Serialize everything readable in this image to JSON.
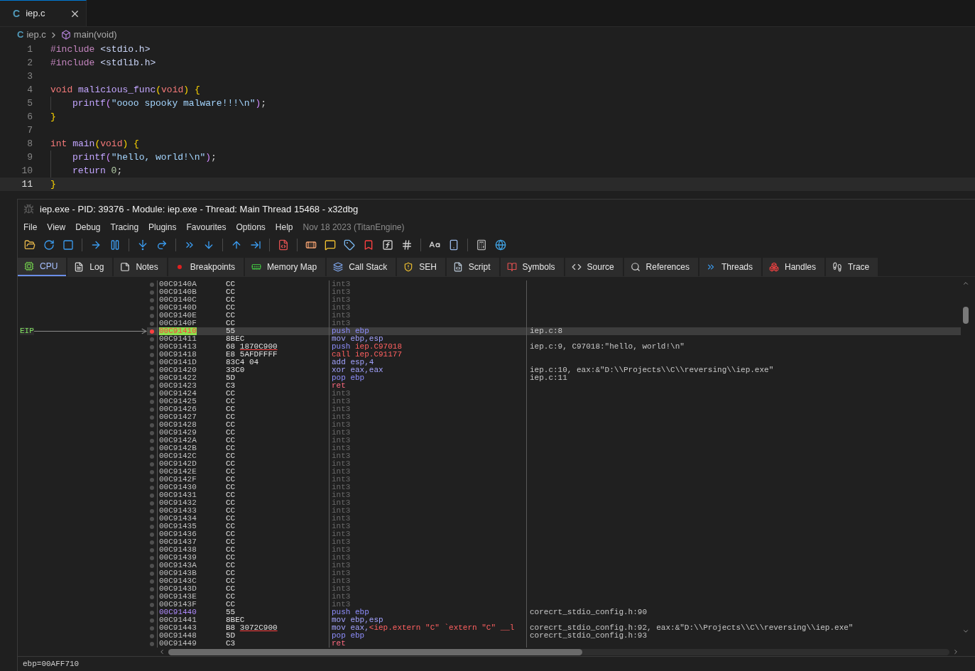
{
  "editor": {
    "tab": {
      "glyph": "C",
      "label": "iep.c",
      "selected": true
    },
    "breadcrumb": {
      "file_glyph": "C",
      "file": "iep.c",
      "symbol": "main(void)"
    },
    "lines": [
      {
        "number": "1",
        "indented": false,
        "selected": false,
        "tokens": [
          {
            "text": "#include",
            "kind": "preproc"
          },
          {
            "text": " <stdio.h>",
            "kind": "path"
          }
        ]
      },
      {
        "number": "2",
        "indented": false,
        "selected": false,
        "tokens": [
          {
            "text": "#include",
            "kind": "preproc"
          },
          {
            "text": " <stdlib.h>",
            "kind": "path"
          }
        ]
      },
      {
        "number": "3",
        "selected": false
      },
      {
        "number": "4",
        "indented": false,
        "selected": false,
        "tokens": [
          {
            "text": "void",
            "kind": "keyword"
          },
          {
            "text": " malicious_func",
            "kind": "func"
          },
          {
            "text": "(",
            "kind": "paren"
          },
          {
            "text": "void",
            "kind": "keyword"
          },
          {
            "text": ")",
            "kind": "paren"
          },
          {
            "text": " {",
            "kind": "paren"
          }
        ]
      },
      {
        "number": "5",
        "indented": true,
        "selected": false,
        "tokens": [
          {
            "text": "printf",
            "kind": "func"
          },
          {
            "text": "(",
            "kind": "paren2"
          },
          {
            "text": "\"oooo spooky malware!!!\\n\"",
            "kind": "string"
          },
          {
            "text": ")",
            "kind": "paren2"
          },
          {
            "text": ";",
            "kind": "plain"
          }
        ]
      },
      {
        "number": "6",
        "indented": false,
        "selected": false,
        "tokens": [
          {
            "text": "}",
            "kind": "paren"
          }
        ]
      },
      {
        "number": "7",
        "selected": false
      },
      {
        "number": "8",
        "indented": false,
        "selected": false,
        "tokens": [
          {
            "text": "int",
            "kind": "keyword"
          },
          {
            "text": " main",
            "kind": "func"
          },
          {
            "text": "(",
            "kind": "paren"
          },
          {
            "text": "void",
            "kind": "keyword"
          },
          {
            "text": ")",
            "kind": "paren"
          },
          {
            "text": " {",
            "kind": "paren"
          }
        ]
      },
      {
        "number": "9",
        "indented": true,
        "selected": false,
        "tokens": [
          {
            "text": "printf",
            "kind": "func"
          },
          {
            "text": "(",
            "kind": "paren2"
          },
          {
            "text": "\"hello, world!\\n\"",
            "kind": "string"
          },
          {
            "text": ")",
            "kind": "paren2"
          },
          {
            "text": ";",
            "kind": "plain"
          }
        ]
      },
      {
        "number": "10",
        "indented": true,
        "selected": false,
        "tokens": [
          {
            "text": "return",
            "kind": "control"
          },
          {
            "text": " 0",
            "kind": "number"
          },
          {
            "text": ";",
            "kind": "plain"
          }
        ]
      },
      {
        "number": "11",
        "indented": false,
        "selected": true,
        "tokens": [
          {
            "text": "}",
            "kind": "paren"
          }
        ]
      }
    ]
  },
  "debugger": {
    "title": "iep.exe - PID: 39376 - Module: iep.exe - Thread: Main Thread 15468 - x32dbg",
    "menu": [
      "File",
      "View",
      "Debug",
      "Tracing",
      "Plugins",
      "Favourites",
      "Options",
      "Help"
    ],
    "build_info": "Nov 18 2023 (TitanEngine)",
    "tabs": [
      {
        "label": "CPU",
        "selected": true
      },
      {
        "label": "Log",
        "selected": false
      },
      {
        "label": "Notes",
        "selected": false
      },
      {
        "label": "Breakpoints",
        "selected": false
      },
      {
        "label": "Memory Map",
        "selected": false
      },
      {
        "label": "Call Stack",
        "selected": false
      },
      {
        "label": "SEH",
        "selected": false
      },
      {
        "label": "Script",
        "selected": false
      },
      {
        "label": "Symbols",
        "selected": false
      },
      {
        "label": "Source",
        "selected": false
      },
      {
        "label": "References",
        "selected": false
      },
      {
        "label": "Threads",
        "selected": false
      },
      {
        "label": "Handles",
        "selected": false
      },
      {
        "label": "Trace",
        "selected": false
      }
    ],
    "rows": [
      {
        "address": "00C9140A",
        "kind": "plain",
        "bytes": "CC",
        "instruction": [
          {
            "text": "int3",
            "kind": "int3"
          }
        ],
        "selected": false,
        "breakpoint": false
      },
      {
        "address": "00C9140B",
        "kind": "plain",
        "bytes": "CC",
        "instruction": [
          {
            "text": "int3",
            "kind": "int3"
          }
        ],
        "selected": false,
        "breakpoint": false
      },
      {
        "address": "00C9140C",
        "kind": "plain",
        "bytes": "CC",
        "instruction": [
          {
            "text": "int3",
            "kind": "int3"
          }
        ],
        "selected": false,
        "breakpoint": false
      },
      {
        "address": "00C9140D",
        "kind": "plain",
        "bytes": "CC",
        "instruction": [
          {
            "text": "int3",
            "kind": "int3"
          }
        ],
        "selected": false,
        "breakpoint": false
      },
      {
        "address": "00C9140E",
        "kind": "plain",
        "bytes": "CC",
        "instruction": [
          {
            "text": "int3",
            "kind": "int3"
          }
        ],
        "selected": false,
        "breakpoint": false
      },
      {
        "address": "00C9140F",
        "kind": "plain",
        "bytes": "CC",
        "instruction": [
          {
            "text": "int3",
            "kind": "int3"
          }
        ],
        "selected": false,
        "breakpoint": false
      },
      {
        "address": "00C91410",
        "kind": "eip",
        "eip_label": "EIP",
        "bytes": "55",
        "instruction": [
          {
            "text": "push ebp",
            "kind": "stack"
          }
        ],
        "comment": "iep.c:8",
        "selected": true,
        "breakpoint": true
      },
      {
        "address": "00C91411",
        "kind": "plain",
        "bytes": "8BEC",
        "instruction": [
          {
            "text": "mov ebp,esp",
            "kind": "alu"
          }
        ],
        "selected": false,
        "breakpoint": false
      },
      {
        "address": "00C91413",
        "kind": "plain",
        "bytes": "68",
        "bytes_ref": "1870C900",
        "instruction": [
          {
            "text": "push ",
            "kind": "stack"
          },
          {
            "text": "iep.C97018",
            "kind": "ref"
          }
        ],
        "comment": "iep.c:9, C97018:\"hello, world!\\n\"",
        "selected": false,
        "breakpoint": false
      },
      {
        "address": "00C91418",
        "kind": "plain",
        "bytes": "E8 5AFDFFFF",
        "instruction": [
          {
            "text": "call iep.C91177",
            "kind": "call"
          }
        ],
        "selected": false,
        "breakpoint": false
      },
      {
        "address": "00C9141D",
        "kind": "plain",
        "bytes": "83C4 04",
        "instruction": [
          {
            "text": "add esp,4",
            "kind": "alu"
          }
        ],
        "selected": false,
        "breakpoint": false
      },
      {
        "address": "00C91420",
        "kind": "plain",
        "bytes": "33C0",
        "instruction": [
          {
            "text": "xor eax,eax",
            "kind": "alu"
          }
        ],
        "comment": "iep.c:10, eax:&\"D:\\\\Projects\\\\C\\\\reversing\\\\iep.exe\"",
        "selected": false,
        "breakpoint": false
      },
      {
        "address": "00C91422",
        "kind": "plain",
        "bytes": "5D",
        "instruction": [
          {
            "text": "pop ebp",
            "kind": "stack"
          }
        ],
        "comment": "iep.c:11",
        "selected": false,
        "breakpoint": false
      },
      {
        "address": "00C91423",
        "kind": "plain",
        "bytes": "C3",
        "instruction": [
          {
            "text": "ret",
            "kind": "ret"
          }
        ],
        "selected": false,
        "breakpoint": false
      },
      {
        "address": "00C91424",
        "kind": "plain",
        "bytes": "CC",
        "instruction": [
          {
            "text": "int3",
            "kind": "int3"
          }
        ],
        "selected": false,
        "breakpoint": false
      },
      {
        "address": "00C91425",
        "kind": "plain",
        "bytes": "CC",
        "instruction": [
          {
            "text": "int3",
            "kind": "int3"
          }
        ],
        "selected": false,
        "breakpoint": false
      },
      {
        "address": "00C91426",
        "kind": "plain",
        "bytes": "CC",
        "instruction": [
          {
            "text": "int3",
            "kind": "int3"
          }
        ],
        "selected": false,
        "breakpoint": false
      },
      {
        "address": "00C91427",
        "kind": "plain",
        "bytes": "CC",
        "instruction": [
          {
            "text": "int3",
            "kind": "int3"
          }
        ],
        "selected": false,
        "breakpoint": false
      },
      {
        "address": "00C91428",
        "kind": "plain",
        "bytes": "CC",
        "instruction": [
          {
            "text": "int3",
            "kind": "int3"
          }
        ],
        "selected": false,
        "breakpoint": false
      },
      {
        "address": "00C91429",
        "kind": "plain",
        "bytes": "CC",
        "instruction": [
          {
            "text": "int3",
            "kind": "int3"
          }
        ],
        "selected": false,
        "breakpoint": false
      },
      {
        "address": "00C9142A",
        "kind": "plain",
        "bytes": "CC",
        "instruction": [
          {
            "text": "int3",
            "kind": "int3"
          }
        ],
        "selected": false,
        "breakpoint": false
      },
      {
        "address": "00C9142B",
        "kind": "plain",
        "bytes": "CC",
        "instruction": [
          {
            "text": "int3",
            "kind": "int3"
          }
        ],
        "selected": false,
        "breakpoint": false
      },
      {
        "address": "00C9142C",
        "kind": "plain",
        "bytes": "CC",
        "instruction": [
          {
            "text": "int3",
            "kind": "int3"
          }
        ],
        "selected": false,
        "breakpoint": false
      },
      {
        "address": "00C9142D",
        "kind": "plain",
        "bytes": "CC",
        "instruction": [
          {
            "text": "int3",
            "kind": "int3"
          }
        ],
        "selected": false,
        "breakpoint": false
      },
      {
        "address": "00C9142E",
        "kind": "plain",
        "bytes": "CC",
        "instruction": [
          {
            "text": "int3",
            "kind": "int3"
          }
        ],
        "selected": false,
        "breakpoint": false
      },
      {
        "address": "00C9142F",
        "kind": "plain",
        "bytes": "CC",
        "instruction": [
          {
            "text": "int3",
            "kind": "int3"
          }
        ],
        "selected": false,
        "breakpoint": false
      },
      {
        "address": "00C91430",
        "kind": "plain",
        "bytes": "CC",
        "instruction": [
          {
            "text": "int3",
            "kind": "int3"
          }
        ],
        "selected": false,
        "breakpoint": false
      },
      {
        "address": "00C91431",
        "kind": "plain",
        "bytes": "CC",
        "instruction": [
          {
            "text": "int3",
            "kind": "int3"
          }
        ],
        "selected": false,
        "breakpoint": false
      },
      {
        "address": "00C91432",
        "kind": "plain",
        "bytes": "CC",
        "instruction": [
          {
            "text": "int3",
            "kind": "int3"
          }
        ],
        "selected": false,
        "breakpoint": false
      },
      {
        "address": "00C91433",
        "kind": "plain",
        "bytes": "CC",
        "instruction": [
          {
            "text": "int3",
            "kind": "int3"
          }
        ],
        "selected": false,
        "breakpoint": false
      },
      {
        "address": "00C91434",
        "kind": "plain",
        "bytes": "CC",
        "instruction": [
          {
            "text": "int3",
            "kind": "int3"
          }
        ],
        "selected": false,
        "breakpoint": false
      },
      {
        "address": "00C91435",
        "kind": "plain",
        "bytes": "CC",
        "instruction": [
          {
            "text": "int3",
            "kind": "int3"
          }
        ],
        "selected": false,
        "breakpoint": false
      },
      {
        "address": "00C91436",
        "kind": "plain",
        "bytes": "CC",
        "instruction": [
          {
            "text": "int3",
            "kind": "int3"
          }
        ],
        "selected": false,
        "breakpoint": false
      },
      {
        "address": "00C91437",
        "kind": "plain",
        "bytes": "CC",
        "instruction": [
          {
            "text": "int3",
            "kind": "int3"
          }
        ],
        "selected": false,
        "breakpoint": false
      },
      {
        "address": "00C91438",
        "kind": "plain",
        "bytes": "CC",
        "instruction": [
          {
            "text": "int3",
            "kind": "int3"
          }
        ],
        "selected": false,
        "breakpoint": false
      },
      {
        "address": "00C91439",
        "kind": "plain",
        "bytes": "CC",
        "instruction": [
          {
            "text": "int3",
            "kind": "int3"
          }
        ],
        "selected": false,
        "breakpoint": false
      },
      {
        "address": "00C9143A",
        "kind": "plain",
        "bytes": "CC",
        "instruction": [
          {
            "text": "int3",
            "kind": "int3"
          }
        ],
        "selected": false,
        "breakpoint": false
      },
      {
        "address": "00C9143B",
        "kind": "plain",
        "bytes": "CC",
        "instruction": [
          {
            "text": "int3",
            "kind": "int3"
          }
        ],
        "selected": false,
        "breakpoint": false
      },
      {
        "address": "00C9143C",
        "kind": "plain",
        "bytes": "CC",
        "instruction": [
          {
            "text": "int3",
            "kind": "int3"
          }
        ],
        "selected": false,
        "breakpoint": false
      },
      {
        "address": "00C9143D",
        "kind": "plain",
        "bytes": "CC",
        "instruction": [
          {
            "text": "int3",
            "kind": "int3"
          }
        ],
        "selected": false,
        "breakpoint": false
      },
      {
        "address": "00C9143E",
        "kind": "plain",
        "bytes": "CC",
        "instruction": [
          {
            "text": "int3",
            "kind": "int3"
          }
        ],
        "selected": false,
        "breakpoint": false
      },
      {
        "address": "00C9143F",
        "kind": "plain",
        "bytes": "CC",
        "instruction": [
          {
            "text": "int3",
            "kind": "int3"
          }
        ],
        "selected": false,
        "breakpoint": false
      },
      {
        "address": "00C91440",
        "kind": "label",
        "bytes": "55",
        "instruction": [
          {
            "text": "push ebp",
            "kind": "stack"
          }
        ],
        "comment": "corecrt_stdio_config.h:90",
        "selected": false,
        "breakpoint": false
      },
      {
        "address": "00C91441",
        "kind": "plain",
        "bytes": "8BEC",
        "instruction": [
          {
            "text": "mov ebp,esp",
            "kind": "alu"
          }
        ],
        "selected": false,
        "breakpoint": false
      },
      {
        "address": "00C91443",
        "kind": "plain",
        "bytes": "B8",
        "bytes_ref": "3072C900",
        "instruction": [
          {
            "text": "mov eax,",
            "kind": "alu"
          },
          {
            "text": "<iep.extern \"C\" `extern \"C\" __l",
            "kind": "ref"
          }
        ],
        "comment": "corecrt_stdio_config.h:92, eax:&\"D:\\\\Projects\\\\C\\\\reversing\\\\iep.exe\"",
        "selected": false,
        "breakpoint": false
      },
      {
        "address": "00C91448",
        "kind": "plain",
        "bytes": "5D",
        "instruction": [
          {
            "text": "pop ebp",
            "kind": "stack"
          }
        ],
        "comment": "corecrt_stdio_config.h:93",
        "selected": false,
        "breakpoint": false
      },
      {
        "address": "00C91449",
        "kind": "plain",
        "bytes": "C3",
        "instruction": [
          {
            "text": "ret",
            "kind": "ret"
          }
        ],
        "selected": false,
        "breakpoint": false
      }
    ],
    "status": "ebp=00AFF710"
  }
}
